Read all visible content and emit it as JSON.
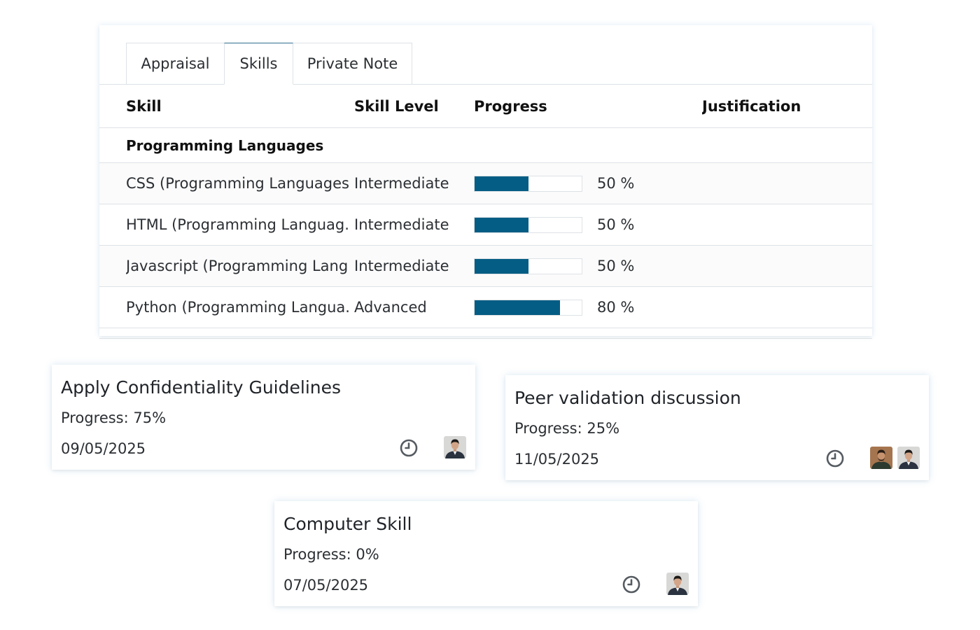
{
  "tabs": [
    {
      "label": "Appraisal"
    },
    {
      "label": "Skills"
    },
    {
      "label": "Private Note"
    }
  ],
  "skills_table": {
    "columns": {
      "skill": "Skill",
      "level": "Skill Level",
      "progress": "Progress",
      "justification": "Justification"
    },
    "group": "Programming Languages",
    "rows": [
      {
        "skill": "CSS (Programming Languages)",
        "level": "Intermediate",
        "progress": 50,
        "progress_label": "50 %"
      },
      {
        "skill": "HTML (Programming Languag...",
        "level": "Intermediate",
        "progress": 50,
        "progress_label": "50 %"
      },
      {
        "skill": "Javascript (Programming Lang...",
        "level": "Intermediate",
        "progress": 50,
        "progress_label": "50 %"
      },
      {
        "skill": "Python (Programming Langua...",
        "level": "Advanced",
        "progress": 80,
        "progress_label": "80 %"
      }
    ]
  },
  "cards": [
    {
      "title": "Apply Confidentiality Guidelines",
      "progress": "Progress: 75%",
      "date": "09/05/2025",
      "avatars": 1
    },
    {
      "title": "Peer validation discussion",
      "progress": "Progress: 25%",
      "date": "11/05/2025",
      "avatars": 2
    },
    {
      "title": "Computer Skill",
      "progress": "Progress: 0%",
      "date": "07/05/2025",
      "avatars": 1
    }
  ],
  "colors": {
    "progress_fill": "#045d84",
    "active_tab_border": "#2f6e8e",
    "border": "#dee2e6"
  },
  "icons": {
    "clock": "clock-icon",
    "avatar": "user-avatar"
  }
}
